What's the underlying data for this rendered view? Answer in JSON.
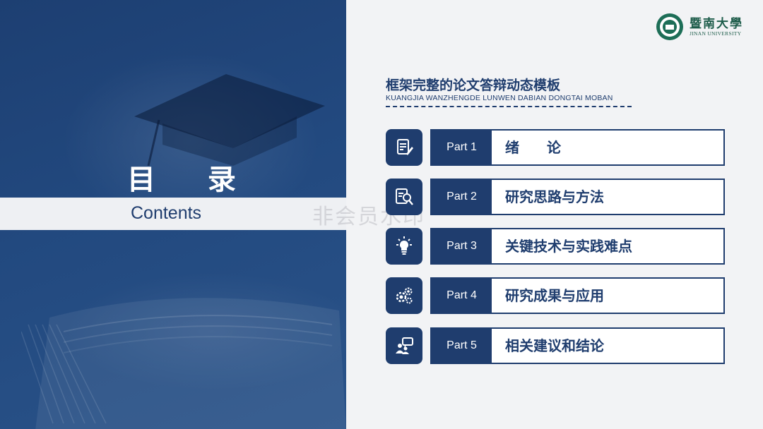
{
  "left": {
    "title": "目 录",
    "subtitle": "Contents"
  },
  "watermark": "非会员水印",
  "logo": {
    "name_cn": "暨南大學",
    "name_en": "JINAN UNIVERSITY",
    "icon": "university-seal-icon"
  },
  "header": {
    "title": "框架完整的论文答辩动态模板",
    "subtitle": "KUANGJIA WANZHENGDE LUNWEN DABIAN DONGTAI MOBAN"
  },
  "items": [
    {
      "part": "Part 1",
      "label": "绪  论",
      "icon": "document-pen-icon"
    },
    {
      "part": "Part 2",
      "label": "研究思路与方法",
      "icon": "document-search-icon"
    },
    {
      "part": "Part 3",
      "label": "关键技术与实践难点",
      "icon": "lightbulb-icon"
    },
    {
      "part": "Part 4",
      "label": "研究成果与应用",
      "icon": "gears-icon"
    },
    {
      "part": "Part 5",
      "label": "相关建议和结论",
      "icon": "people-chat-icon"
    }
  ],
  "colors": {
    "primary": "#1f3d6e",
    "logo_green": "#1d6e57",
    "background": "#f2f3f5"
  }
}
